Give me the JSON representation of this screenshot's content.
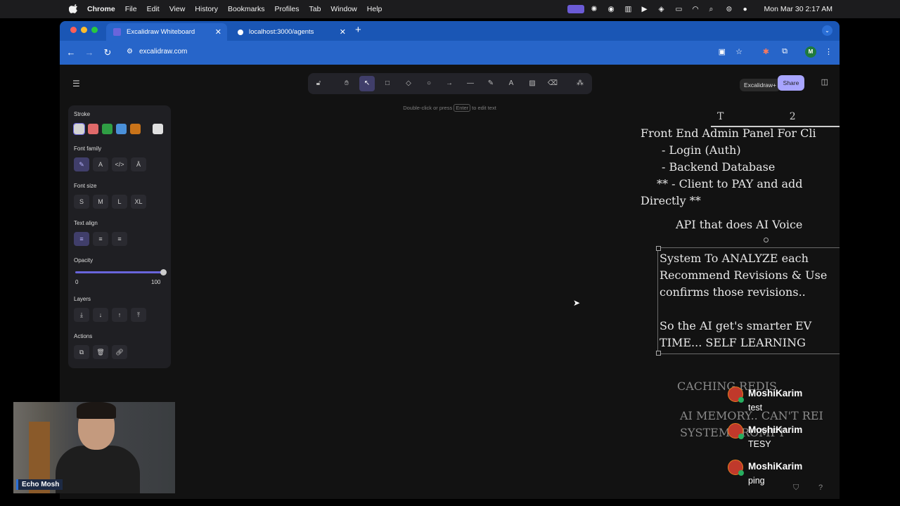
{
  "menubar": {
    "app": "Chrome",
    "items": [
      "File",
      "Edit",
      "View",
      "History",
      "Bookmarks",
      "Profiles",
      "Tab",
      "Window",
      "Help"
    ],
    "clock": "Mon Mar 30  2:17 AM"
  },
  "browser": {
    "tabs": [
      {
        "title": "Excalidraw Whiteboard",
        "active": true
      },
      {
        "title": "localhost:3000/agents",
        "active": false
      }
    ],
    "url": "excalidraw.com",
    "profile_initial": "M"
  },
  "excalidraw": {
    "hint": {
      "before": "Double-click or press",
      "key": "Enter",
      "after": "to edit text"
    },
    "brand": "Excalidraw+",
    "share_label": "Share",
    "props": {
      "stroke_label": "Stroke",
      "stroke_colors": [
        "#d3d3d3",
        "#e06a6a",
        "#2f9e44",
        "#4a90d9",
        "#c97319",
        "#e0e0e0"
      ],
      "font_family_label": "Font family",
      "font_size_label": "Font size",
      "font_sizes": [
        "S",
        "M",
        "L",
        "XL"
      ],
      "text_align_label": "Text align",
      "opacity_label": "Opacity",
      "opacity_min": "0",
      "opacity_max": "100",
      "opacity_value": 100,
      "layers_label": "Layers",
      "actions_label": "Actions"
    },
    "board": {
      "line1": "Front End Admin Panel For Cli",
      "line2": "- Login (Auth)",
      "line3": "- Backend Database",
      "line4": "** - Client to PAY and add",
      "line5": "Directly **",
      "line6": "API that does AI Voice",
      "sel1": "System To ANALYZE each",
      "sel2": "Recommend Revisions & Use",
      "sel3": "confirms those revisions..",
      "sel4": "So the AI get's smarter EV",
      "sel5": "TIME... SELF LEARNING",
      "cache": "CACHING REDIS",
      "mem1": "AI MEMORY.. CAN'T REI",
      "mem2": "SYSTEM PROMPT"
    }
  },
  "chat": [
    {
      "user": "MoshiKarim",
      "text": "test"
    },
    {
      "user": "MoshiKarim",
      "text": "TESY"
    },
    {
      "user": "MoshiKarim",
      "text": "ping"
    }
  ],
  "webcam": {
    "name": "Echo Mosh"
  }
}
